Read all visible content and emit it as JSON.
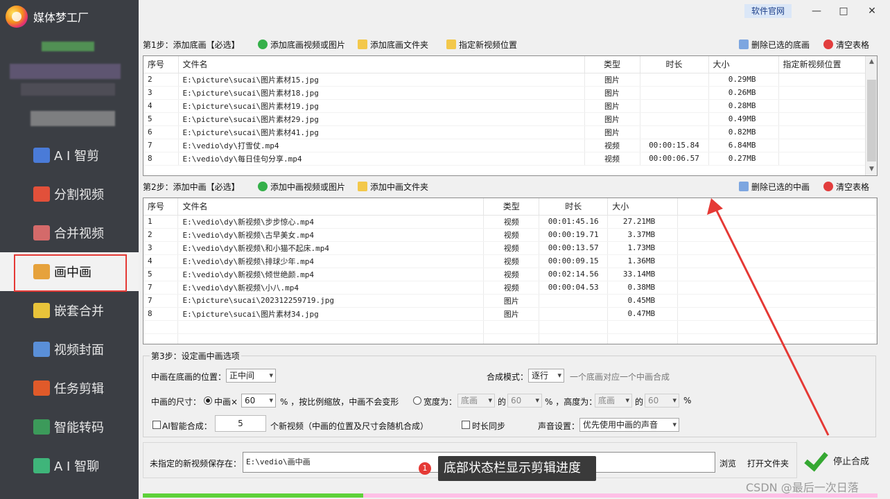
{
  "app": {
    "title": "媒体梦工厂"
  },
  "titlebar": {
    "site_label": "软件官网",
    "minimize": "—",
    "maximize": "□",
    "close": "✕"
  },
  "sidebar": {
    "items": [
      {
        "label": "A I 智剪",
        "icon": "ai-cut-icon",
        "color": "#4a7bd8"
      },
      {
        "label": "分割视频",
        "icon": "split-video-icon",
        "color": "#e2503a"
      },
      {
        "label": "合并视频",
        "icon": "merge-video-icon",
        "color": "#d46a6a"
      },
      {
        "label": "画中画",
        "icon": "picture-in-picture-icon",
        "color": "#e6a23c",
        "active": true
      },
      {
        "label": "嵌套合并",
        "icon": "nested-merge-icon",
        "color": "#e8c33a"
      },
      {
        "label": "视频封面",
        "icon": "video-cover-icon",
        "color": "#5a8fd8"
      },
      {
        "label": "任务剪辑",
        "icon": "task-edit-icon",
        "color": "#e05a2a"
      },
      {
        "label": "智能转码",
        "icon": "smart-transcode-icon",
        "color": "#3c9a5a"
      },
      {
        "label": "A I 智聊",
        "icon": "ai-chat-icon",
        "color": "#3fb57a"
      }
    ]
  },
  "step1": {
    "label": "第1步：添加底画【必选】",
    "add_files": "添加底画视频或图片",
    "add_folder": "添加底画文件夹",
    "set_location": "指定新视频位置",
    "delete_selected": "删除已选的底画",
    "clear_table": "清空表格",
    "columns": [
      "序号",
      "文件名",
      "类型",
      "时长",
      "大小",
      "指定新视频位置"
    ],
    "rows": [
      [
        "2",
        "E:\\picture\\sucai\\图片素材15.jpg",
        "图片",
        "",
        "0.29MB",
        ""
      ],
      [
        "3",
        "E:\\picture\\sucai\\图片素材18.jpg",
        "图片",
        "",
        "0.26MB",
        ""
      ],
      [
        "4",
        "E:\\picture\\sucai\\图片素材19.jpg",
        "图片",
        "",
        "0.28MB",
        ""
      ],
      [
        "5",
        "E:\\picture\\sucai\\图片素材29.jpg",
        "图片",
        "",
        "0.49MB",
        ""
      ],
      [
        "6",
        "E:\\picture\\sucai\\图片素材41.jpg",
        "图片",
        "",
        "0.82MB",
        ""
      ],
      [
        "7",
        "E:\\vedio\\dy\\打雪仗.mp4",
        "视频",
        "00:00:15.84",
        "6.84MB",
        ""
      ],
      [
        "8",
        "E:\\vedio\\dy\\每日佳句分享.mp4",
        "视频",
        "00:00:06.57",
        "0.27MB",
        ""
      ]
    ]
  },
  "step2": {
    "label": "第2步：添加中画【必选】",
    "add_files": "添加中画视频或图片",
    "add_folder": "添加中画文件夹",
    "delete_selected": "删除已选的中画",
    "clear_table": "清空表格",
    "columns": [
      "序号",
      "文件名",
      "类型",
      "时长",
      "大小"
    ],
    "rows": [
      [
        "1",
        "E:\\vedio\\dy\\新视频\\步步惊心.mp4",
        "视频",
        "00:01:45.16",
        "27.21MB"
      ],
      [
        "2",
        "E:\\vedio\\dy\\新视频\\古早美女.mp4",
        "视频",
        "00:00:19.71",
        "3.37MB"
      ],
      [
        "3",
        "E:\\vedio\\dy\\新视频\\和小猫不起床.mp4",
        "视频",
        "00:00:13.57",
        "1.73MB"
      ],
      [
        "4",
        "E:\\vedio\\dy\\新视频\\排球少年.mp4",
        "视频",
        "00:00:09.15",
        "1.36MB"
      ],
      [
        "5",
        "E:\\vedio\\dy\\新视频\\倾世绝颜.mp4",
        "视频",
        "00:02:14.56",
        "33.14MB"
      ],
      [
        "7",
        "E:\\vedio\\dy\\新视频\\小八.mp4",
        "视频",
        "00:00:04.53",
        "0.38MB"
      ],
      [
        "7",
        "E:\\picture\\sucai\\202312259719.jpg",
        "图片",
        "",
        "0.45MB"
      ],
      [
        "8",
        "E:\\picture\\sucai\\图片素材34.jpg",
        "图片",
        "",
        "0.47MB"
      ]
    ]
  },
  "step3": {
    "label": "第3步：设定画中画选项",
    "position_label": "中画在底画的位置：",
    "position_value": "正中间",
    "mode_label": "合成模式：",
    "mode_value": "逐行",
    "mode_hint": "一个底画对应一个中画合成",
    "size_label": "中画的尺寸：",
    "size_radio": "中画×",
    "size_value": "60",
    "size_hint": "% ，按比例缩放，中画不会变形",
    "width_radio": "宽度为：",
    "width_base": "底画",
    "width_of": "的",
    "width_value": "60",
    "height_sep": "% ，高度为：",
    "height_base": "底画",
    "height_of": "的",
    "height_value": "60",
    "height_pct": "%",
    "ai_label": "AI智能合成：",
    "ai_count": "5",
    "ai_hint": "个新视频（中画的位置及尺寸会随机合成）",
    "sync_label": "时长同步",
    "sound_label": "声音设置：",
    "sound_value": "优先使用中画的声音"
  },
  "output": {
    "label": "未指定的新视频保存在：",
    "path": "E:\\vedio\\画中画",
    "browse": "浏览",
    "open_folder": "打开文件夹",
    "stop": "停止合成"
  },
  "progress": {
    "fraction": 0.3
  },
  "tooltip": {
    "badge": "1",
    "text": "底部状态栏显示剪辑进度"
  },
  "watermark": "CSDN @最后一次日落"
}
